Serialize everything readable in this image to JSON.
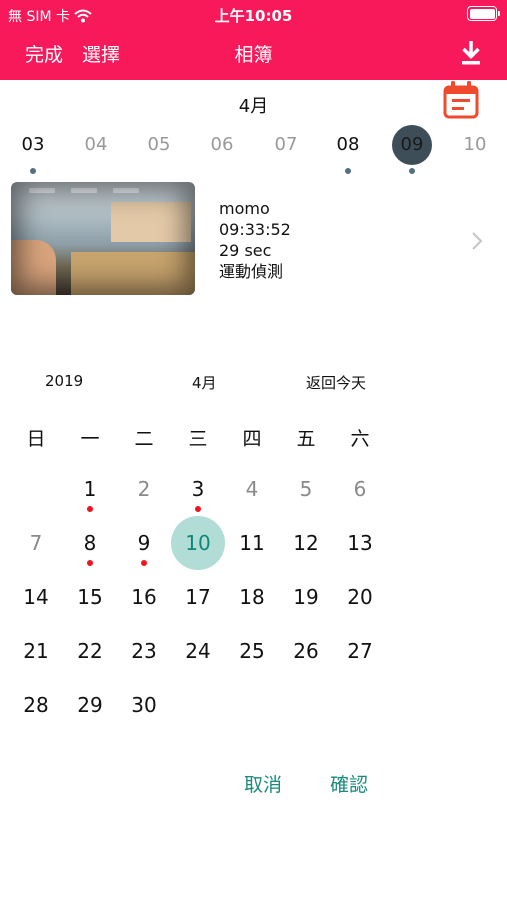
{
  "status_bar": {
    "carrier": "無 SIM 卡",
    "time": "上午10:05",
    "wifi_icon": "wifi-icon",
    "battery_icon": "battery-icon"
  },
  "nav": {
    "done_label": "完成",
    "select_label": "選擇",
    "title": "相簿",
    "download_icon": "download-icon"
  },
  "month_title": "4月",
  "calendar_button_icon": "calendar-icon",
  "date_strip": [
    {
      "label": "03",
      "has_clip": true,
      "available": true,
      "selected": false
    },
    {
      "label": "04",
      "has_clip": false,
      "available": false,
      "selected": false
    },
    {
      "label": "05",
      "has_clip": false,
      "available": false,
      "selected": false
    },
    {
      "label": "06",
      "has_clip": false,
      "available": false,
      "selected": false
    },
    {
      "label": "07",
      "has_clip": false,
      "available": false,
      "selected": false
    },
    {
      "label": "08",
      "has_clip": true,
      "available": true,
      "selected": false
    },
    {
      "label": "09",
      "has_clip": true,
      "available": true,
      "selected": true
    },
    {
      "label": "10",
      "has_clip": false,
      "available": false,
      "selected": false
    }
  ],
  "clip": {
    "name": "momo",
    "time": "09:33:52",
    "duration": "29 sec",
    "event": "運動偵測",
    "chevron_icon": "chevron-right-icon"
  },
  "picker": {
    "year": "2019",
    "month": "4月",
    "today_label": "返回今天",
    "weekdays": [
      "日",
      "一",
      "二",
      "三",
      "四",
      "五",
      "六"
    ],
    "weeks": [
      [
        null,
        {
          "d": "1",
          "rec": true
        },
        {
          "d": "2",
          "muted": true
        },
        {
          "d": "3",
          "rec": true
        },
        {
          "d": "4",
          "muted": true
        },
        {
          "d": "5",
          "muted": true
        },
        {
          "d": "6",
          "muted": true
        }
      ],
      [
        {
          "d": "7",
          "muted": true
        },
        {
          "d": "8",
          "rec": true
        },
        {
          "d": "9",
          "rec": true
        },
        {
          "d": "10",
          "selected": true
        },
        {
          "d": "11"
        },
        {
          "d": "12"
        },
        {
          "d": "13"
        }
      ],
      [
        {
          "d": "14"
        },
        {
          "d": "15"
        },
        {
          "d": "16"
        },
        {
          "d": "17"
        },
        {
          "d": "18"
        },
        {
          "d": "19"
        },
        {
          "d": "20"
        }
      ],
      [
        {
          "d": "21"
        },
        {
          "d": "22"
        },
        {
          "d": "23"
        },
        {
          "d": "24"
        },
        {
          "d": "25"
        },
        {
          "d": "26"
        },
        {
          "d": "27"
        }
      ],
      [
        {
          "d": "28"
        },
        {
          "d": "29"
        },
        {
          "d": "30"
        },
        null,
        null,
        null,
        null
      ]
    ],
    "cancel_label": "取消",
    "confirm_label": "確認"
  },
  "colors": {
    "brand": "#f7195a",
    "accent": "#1a8a7d",
    "selected_day_bg": "#b2dcd6",
    "record_dot": "#f4141e",
    "strip_selected": "#3e4e58"
  }
}
